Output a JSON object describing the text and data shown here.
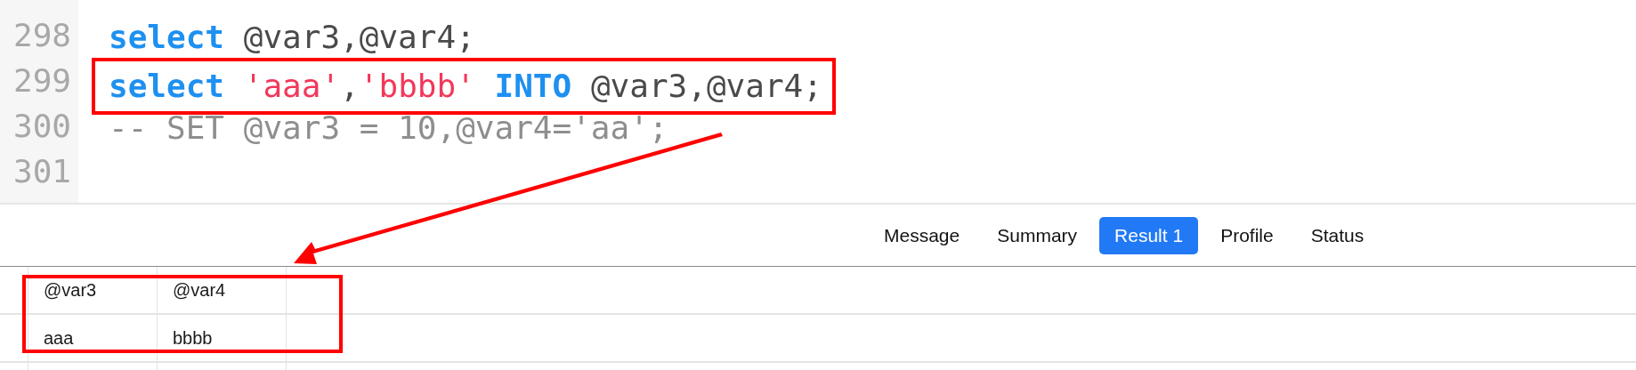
{
  "editor": {
    "lines": [
      {
        "number": "298",
        "highlighted": false,
        "tokens": [
          {
            "kind": "keyword",
            "text": "select"
          },
          {
            "kind": "plain",
            "text": " @var3,@var4;"
          }
        ]
      },
      {
        "number": "299",
        "highlighted": true,
        "tokens": [
          {
            "kind": "keyword",
            "text": "select "
          },
          {
            "kind": "string",
            "text": "'aaa'"
          },
          {
            "kind": "plain",
            "text": ","
          },
          {
            "kind": "string",
            "text": "'bbbb'"
          },
          {
            "kind": "keyword",
            "text": " INTO"
          },
          {
            "kind": "plain",
            "text": " @var3,@var4;"
          }
        ]
      },
      {
        "number": "300",
        "highlighted": false,
        "tokens": [
          {
            "kind": "comment",
            "text": "-- SET @var3 = 10,@var4='aa';"
          }
        ]
      },
      {
        "number": "301",
        "highlighted": false
      }
    ]
  },
  "tabs": [
    {
      "label": "Message",
      "selected": false
    },
    {
      "label": "Summary",
      "selected": false
    },
    {
      "label": "Result 1",
      "selected": true
    },
    {
      "label": "Profile",
      "selected": false
    },
    {
      "label": "Status",
      "selected": false
    }
  ],
  "table": {
    "columns": [
      "@var3",
      "@var4"
    ],
    "rows": [
      [
        "aaa",
        "bbbb"
      ]
    ]
  }
}
